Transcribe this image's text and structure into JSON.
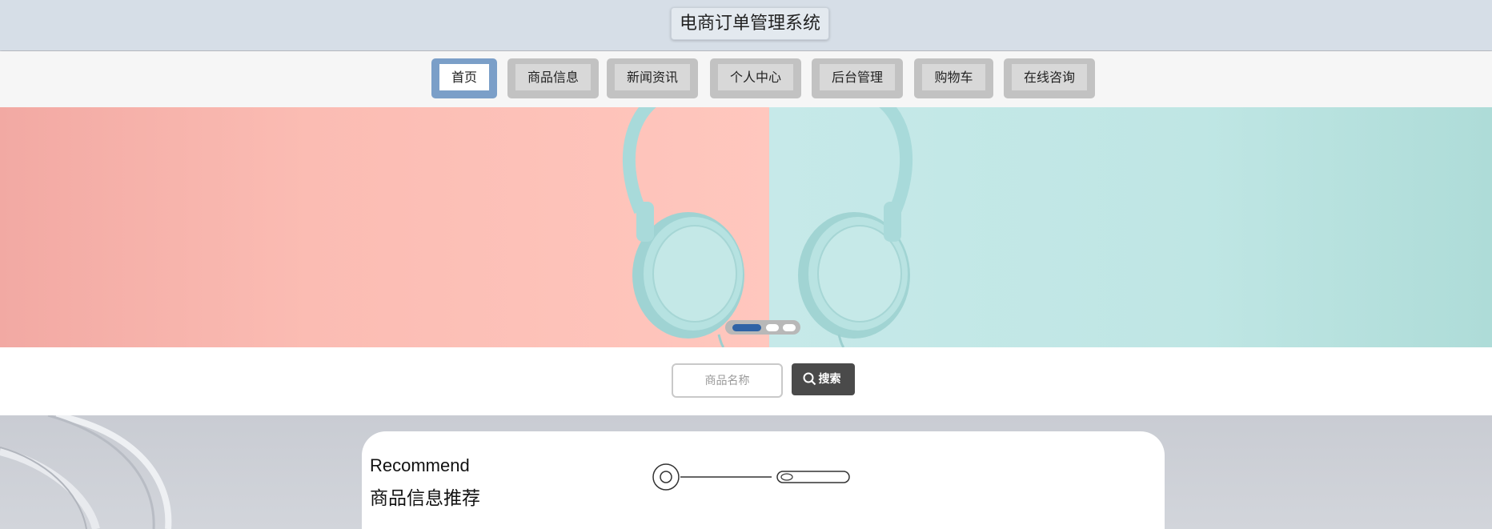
{
  "header": {
    "title": "电商订单管理系统"
  },
  "nav": {
    "items": [
      {
        "label": "首页",
        "active": true
      },
      {
        "label": "商品信息",
        "active": false
      },
      {
        "label": "新闻资讯",
        "active": false
      },
      {
        "label": "个人中心",
        "active": false
      },
      {
        "label": "后台管理",
        "active": false
      },
      {
        "label": "购物车",
        "active": false
      },
      {
        "label": "在线咨询",
        "active": false
      }
    ]
  },
  "banner": {
    "slide_count": 3,
    "active_slide": 1
  },
  "search": {
    "placeholder": "商品名称",
    "button_label": "搜索",
    "button_icon": "search-icon"
  },
  "recommend": {
    "title_en": "Recommend",
    "title_cn": "商品信息推荐"
  },
  "colors": {
    "header_bg": "#d6dee7",
    "nav_active": "#7b9fc8",
    "nav_inactive": "#c2c2c2",
    "dot_active": "#2f63a6",
    "search_button": "#4a4a4a"
  }
}
